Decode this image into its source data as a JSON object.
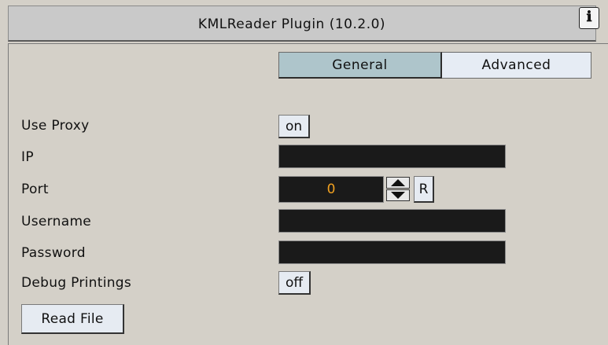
{
  "window": {
    "title": "KMLReader Plugin (10.2.0)",
    "help_icon_glyph": "ℹ"
  },
  "tabs": [
    {
      "label": "General",
      "active": true
    },
    {
      "label": "Advanced",
      "active": false
    }
  ],
  "form": {
    "use_proxy": {
      "label": "Use Proxy",
      "value": "on"
    },
    "ip": {
      "label": "IP",
      "value": ""
    },
    "port": {
      "label": "Port",
      "value": "0",
      "reset_label": "R"
    },
    "username": {
      "label": "Username",
      "value": ""
    },
    "password": {
      "label": "Password",
      "value": ""
    },
    "debug_printings": {
      "label": "Debug Printings",
      "value": "off"
    }
  },
  "actions": {
    "read_file_label": "Read File"
  },
  "colors": {
    "background": "#d4d0c8",
    "active_tab": "#aec5cb",
    "inactive_tab": "#e6ecf4",
    "field_bg": "#1a1a1a",
    "port_value": "#f0a020"
  }
}
